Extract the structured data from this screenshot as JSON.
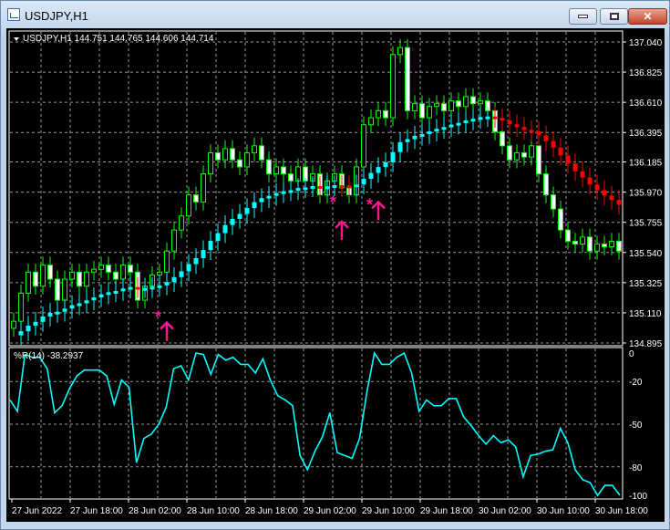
{
  "window": {
    "title": "USDJPY,H1",
    "icon": "chart-window-icon",
    "buttons": [
      "minimize",
      "maximize",
      "close"
    ]
  },
  "chart": {
    "header": "USDJPY,H1  144.751 144.765 144.606 144.714",
    "price_labels": [
      "137.040",
      "136.825",
      "136.610",
      "136.395",
      "136.185",
      "135.970",
      "135.755",
      "135.540",
      "135.325",
      "135.110",
      "134.895"
    ],
    "price_range": [
      134.895,
      137.04
    ],
    "closes": [
      135.05,
      135.25,
      135.4,
      135.3,
      135.45,
      135.35,
      135.2,
      135.35,
      135.4,
      135.3,
      135.4,
      135.42,
      135.45,
      135.4,
      135.35,
      135.45,
      135.4,
      135.2,
      135.3,
      135.38,
      135.4,
      135.55,
      135.7,
      135.8,
      135.95,
      135.9,
      136.1,
      136.25,
      136.2,
      136.28,
      136.2,
      136.15,
      136.25,
      136.3,
      136.2,
      136.1,
      136.15,
      136.1,
      136.05,
      136.15,
      136.05,
      136.1,
      135.95,
      136.05,
      136.1,
      136.0,
      135.95,
      136.15,
      136.45,
      136.5,
      136.55,
      136.5,
      136.95,
      137.0,
      136.55,
      136.6,
      136.5,
      136.58,
      136.6,
      136.55,
      136.62,
      136.58,
      136.65,
      136.6,
      136.62,
      136.55,
      136.4,
      136.3,
      136.2,
      136.25,
      136.22,
      136.3,
      136.1,
      135.95,
      135.85,
      135.7,
      135.62,
      135.6,
      135.65,
      135.55,
      135.6,
      135.58,
      135.62,
      135.55
    ],
    "signals": [
      {
        "bar": 20,
        "price": 135.08,
        "type": "star"
      },
      {
        "bar": 21,
        "price": 135.04,
        "type": "arrow-up"
      },
      {
        "bar": 44,
        "price": 135.9,
        "type": "star"
      },
      {
        "bar": 45,
        "price": 135.76,
        "type": "arrow-up"
      },
      {
        "bar": 49,
        "price": 135.88,
        "type": "star"
      },
      {
        "bar": 50,
        "price": 135.9,
        "type": "arrow-up"
      }
    ],
    "colors": {
      "candle": "#00ff00",
      "ma_up": "#00ffff",
      "ma_down": "#ff0000",
      "signal": "#ff1493",
      "grid": "#9a9a9a"
    }
  },
  "indicator": {
    "label": "%R(14) -38.2937",
    "levels": [
      "0",
      "-20",
      "-50",
      "-80",
      "-100"
    ],
    "range": [
      -100,
      0
    ],
    "values": [
      -33,
      -41,
      -1,
      -3,
      -3,
      -11,
      -42,
      -37,
      -25,
      -16,
      -12,
      -12,
      -12,
      -16,
      -36,
      -19,
      -24,
      -77,
      -60,
      -57,
      -50,
      -38,
      -11,
      -9,
      -19,
      0,
      -1,
      -15,
      -1,
      -5,
      -3,
      -8,
      -8,
      -14,
      -4,
      -19,
      -30,
      -33,
      -37,
      -72,
      -82,
      -69,
      -59,
      -42,
      -70,
      -72,
      -74,
      -60,
      -27,
      0,
      -8,
      -8,
      -3,
      0,
      -14,
      -41,
      -33,
      -37,
      -37,
      -32,
      -32,
      -45,
      -51,
      -58,
      -64,
      -58,
      -63,
      -61,
      -66,
      -87,
      -72,
      -71,
      -69,
      -68,
      -53,
      -63,
      -82,
      -89,
      -91,
      -100,
      -93,
      -93,
      -100
    ],
    "color": "#00ffff"
  },
  "time_labels": [
    "27 Jun 2022",
    "27 Jun 18:00",
    "28 Jun 02:00",
    "28 Jun 10:00",
    "28 Jun 18:00",
    "29 Jun 02:00",
    "29 Jun 10:00",
    "29 Jun 18:00",
    "30 Jun 02:00",
    "30 Jun 10:00",
    "30 Jun 18:00"
  ]
}
